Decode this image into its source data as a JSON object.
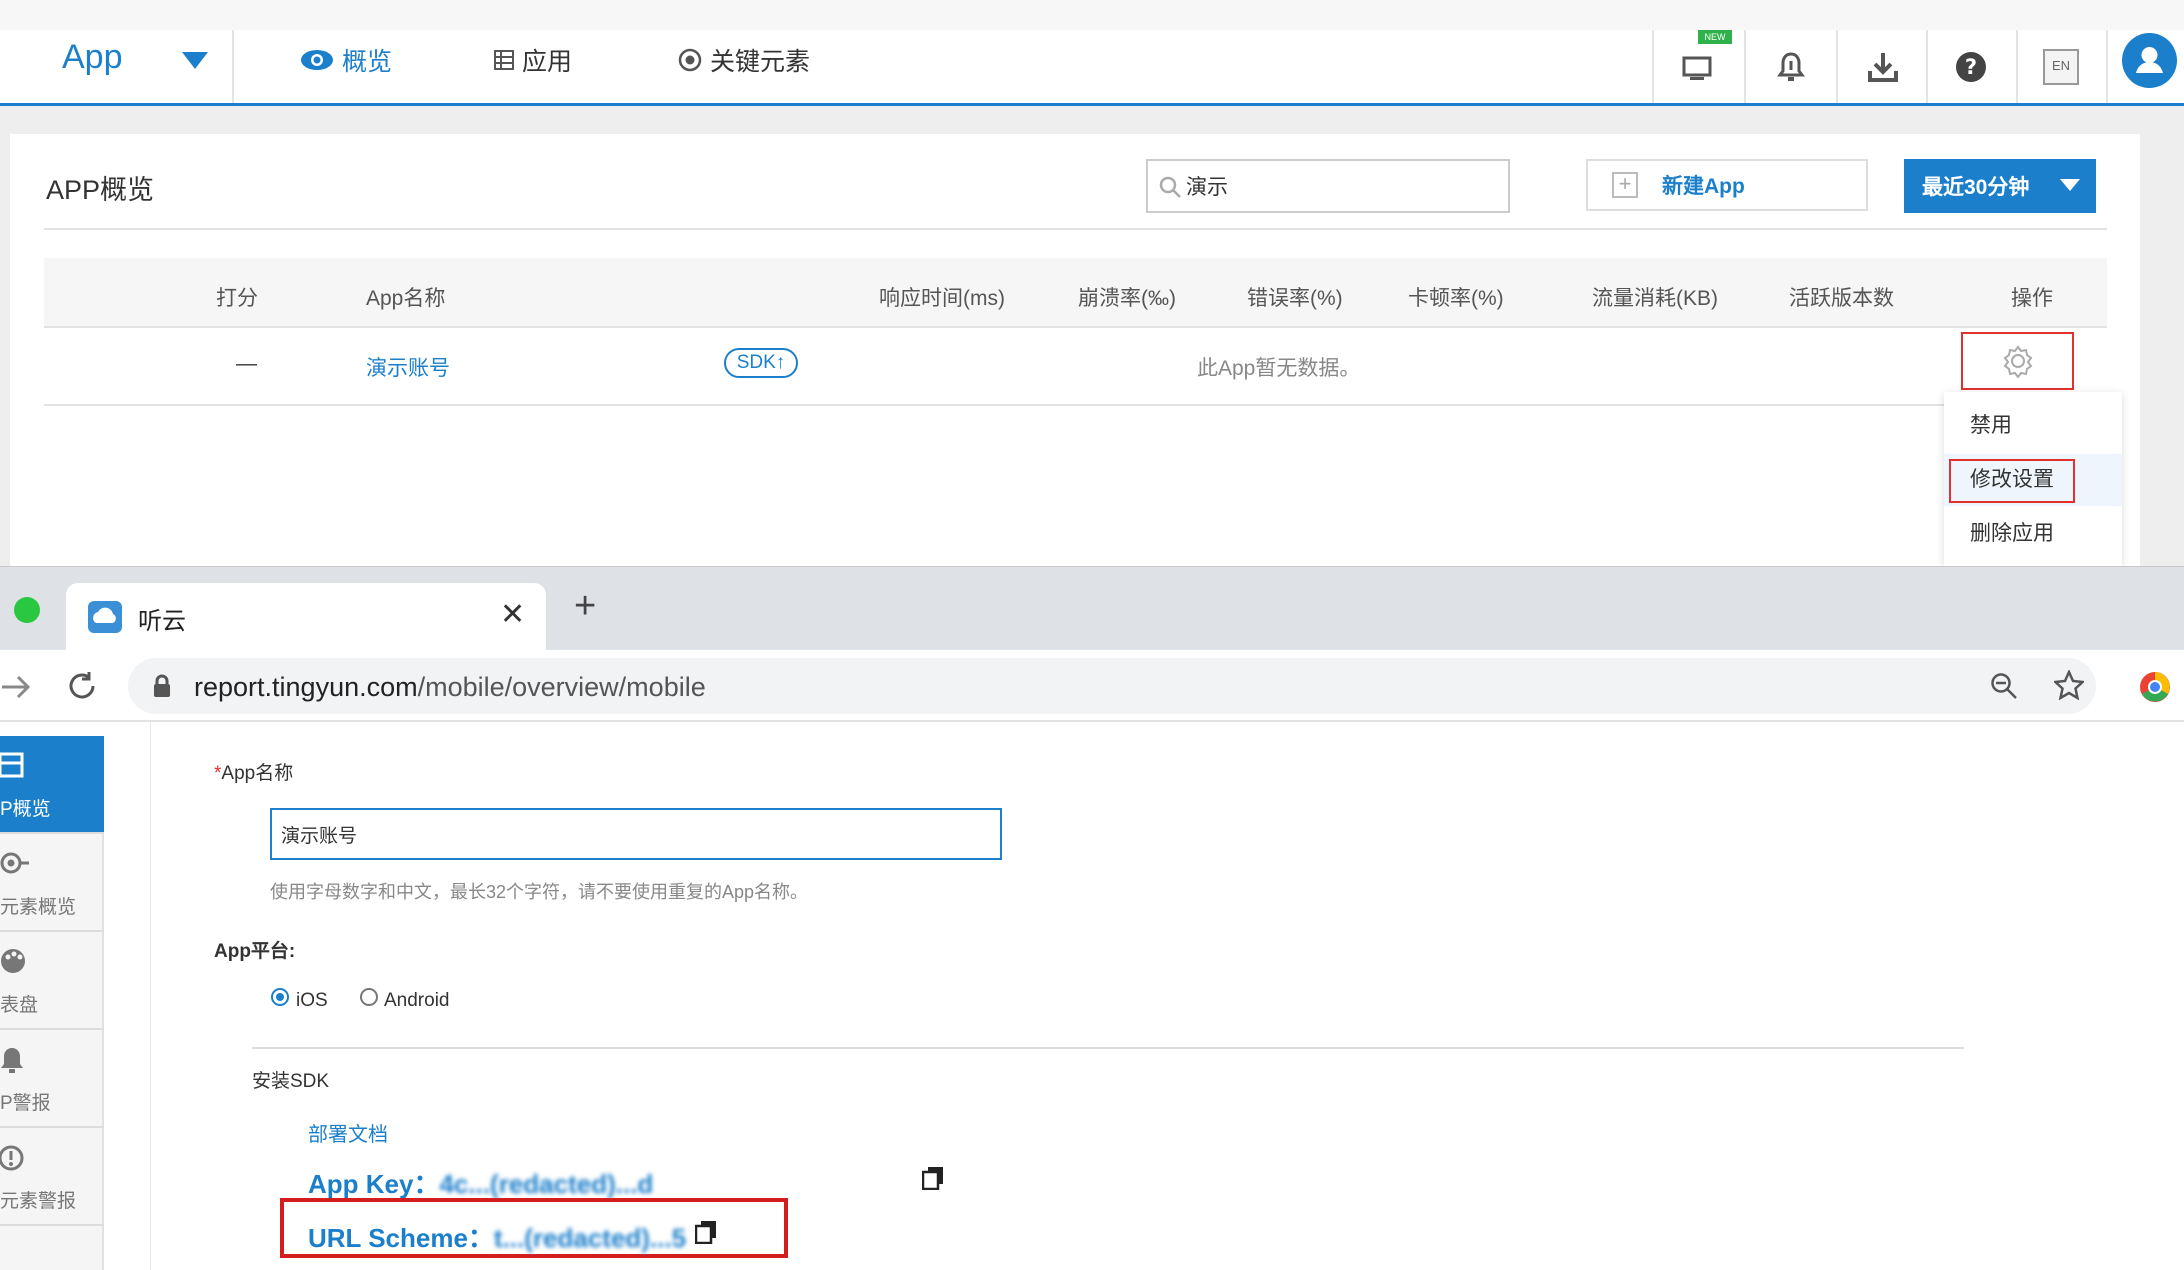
{
  "topnav": {
    "app_label": "App",
    "tabs": [
      {
        "label": "概览",
        "active": true,
        "icon": "eye-icon"
      },
      {
        "label": "应用",
        "icon": "list-icon"
      },
      {
        "label": "关键元素",
        "icon": "target-icon"
      }
    ],
    "badge_new": "NEW",
    "lang_label": "EN",
    "icons": [
      "monitor-icon",
      "bell-icon",
      "download-icon",
      "help-icon",
      "language-icon",
      "user-avatar-icon"
    ]
  },
  "overview": {
    "title": "APP概览",
    "search_value": "演示",
    "new_app_label": "新建App",
    "time_range_label": "最近30分钟",
    "columns": [
      "打分",
      "App名称",
      "响应时间(ms)",
      "崩溃率(‰)",
      "错误率(%)",
      "卡顿率(%)",
      "流量消耗(KB)",
      "活跃版本数",
      "操作"
    ],
    "rows": [
      {
        "score": "—",
        "name": "演示账号",
        "sdk_badge": "SDK↑",
        "message": "此App暂无数据。"
      }
    ],
    "action_menu": [
      "禁用",
      "修改设置",
      "删除应用"
    ]
  },
  "browser": {
    "tab_title": "听云",
    "url_host": "report.tingyun.com",
    "url_path": "/mobile/overview/mobile",
    "sidebar": [
      "P概览",
      "元素概览",
      "表盘",
      "P警报",
      "元素警报"
    ]
  },
  "form": {
    "name_required_mark": "*",
    "name_label": "App名称",
    "name_value": "演示账号",
    "name_hint": "使用字母数字和中文，最长32个字符，请不要使用重复的App名称。",
    "platform_label": "App平台:",
    "platform_options": [
      "iOS",
      "Android"
    ],
    "platform_selected": "iOS",
    "sdk_section": "安装SDK",
    "docs_link": "部署文档",
    "app_key_label": "App Key：",
    "app_key_value": "4c...(redacted)...d",
    "url_scheme_label": "URL Scheme：",
    "url_scheme_value": "t...(redacted)...5"
  },
  "colors": {
    "accent": "#1c7fcb",
    "highlight": "#e03030"
  }
}
